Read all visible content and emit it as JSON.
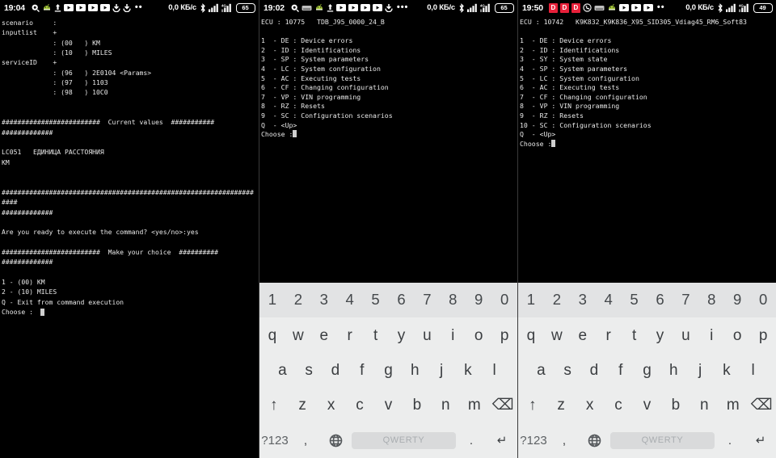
{
  "app": {
    "kind": "android-terminal-diagnostic-app",
    "screens": 3
  },
  "panels": [
    {
      "id": "panel-1",
      "statusbar": {
        "clock": "19:04",
        "net_rate": "0,0 КБ/c",
        "battery": "65",
        "icons": [
          "eye-notification-icon",
          "android-icon",
          "upload-icon",
          "video-icon",
          "video-icon",
          "video-icon",
          "video-icon",
          "download-icon",
          "download-icon",
          "more-dots-icon",
          "bluetooth-icon",
          "signal-bars-icon",
          "signal-4g-bars-icon",
          "battery-icon"
        ]
      },
      "terminal": "scenario     :\ninputlist    +\n             : (00   ) KM\n             : (10   ) MILES\nserviceID    +\n             : (96   ) 2E0104 <Params>\n             : (97   ) 1103\n             : (98   ) 10C0\n\n\n#########################  Current values  ###########\n#############\n\nLC051   ЕДИНИЦА РАССТОЯНИЯ\nKM\n\n\n####################################################################\n#############\n\nAre you ready to execute the command? <yes/no>:yes\n\n#########################  Make your choice  ##########\n#############\n\n1 - (00) KM\n2 - (10) MILES\nQ - Exit from command execution\nChoose :",
      "has_keyboard": false
    },
    {
      "id": "panel-2",
      "statusbar": {
        "clock": "19:02",
        "net_rate": "0,0 КБ/c",
        "battery": "65",
        "icons": [
          "eye-notification-icon",
          "keyboard-icon",
          "android-icon",
          "upload-icon",
          "video-icon",
          "video-icon",
          "video-icon",
          "video-icon",
          "download-icon",
          "more-dots-icon",
          "bluetooth-icon",
          "signal-bars-icon",
          "signal-4g-bars-icon",
          "battery-icon"
        ]
      },
      "terminal_header": "ECU : 10775   TDB_J95_0000_24_B",
      "menu": [
        "1  - DE : Device errors",
        "2  - ID : Identifications",
        "3  - SP : System parameters",
        "4  - LC : System configuration",
        "5  - AC : Executing tests",
        "6  - CF : Changing configuration",
        "7  - VP : VIN programming",
        "8  - RZ : Resets",
        "9  - SC : Configuration scenarios",
        "Q  - <Up>"
      ],
      "prompt": "Choose :",
      "has_keyboard": true
    },
    {
      "id": "panel-3",
      "statusbar": {
        "clock": "19:50",
        "net_rate": "0,0 КБ/c",
        "battery": "49",
        "badges": [
          "D",
          "D",
          "D"
        ],
        "icons": [
          "badge-d-icon",
          "badge-d-icon",
          "badge-d-icon",
          "viber-call-icon",
          "keyboard-icon",
          "android-icon",
          "video-icon",
          "video-icon",
          "video-icon",
          "more-dots-icon",
          "bluetooth-icon",
          "signal-bars-icon",
          "signal-4g-bars-icon",
          "battery-icon"
        ]
      },
      "terminal_header": "ECU : 10742   K9K832_K9K836_X95_SID305_Vdiag45_RM6_Soft83",
      "menu": [
        "1  - DE : Device errors",
        "2  - ID : Identifications",
        "3  - SY : System state",
        "4  - SP : System parameters",
        "5  - LC : System configuration",
        "6  - AC : Executing tests",
        "7  - CF : Changing configuration",
        "8  - VP : VIN programming",
        "9  - RZ : Resets",
        "10 - SC : Configuration scenarios",
        "Q  - <Up>"
      ],
      "prompt": "Choose :",
      "has_keyboard": true
    }
  ],
  "keyboard": {
    "row_numbers": [
      "1",
      "2",
      "3",
      "4",
      "5",
      "6",
      "7",
      "8",
      "9",
      "0"
    ],
    "row_top": [
      "q",
      "w",
      "e",
      "r",
      "t",
      "y",
      "u",
      "i",
      "o",
      "p"
    ],
    "row_home": [
      "a",
      "s",
      "d",
      "f",
      "g",
      "h",
      "j",
      "k",
      "l"
    ],
    "row_bottom": [
      "z",
      "x",
      "c",
      "v",
      "b",
      "n",
      "m"
    ],
    "shift_label": "↑",
    "backspace_label": "⌫",
    "symbols_label": "?123",
    "comma_label": ",",
    "globe_label": "globe-icon",
    "space_label": "QWERTY",
    "period_label": ".",
    "enter_label": "↵"
  },
  "colors": {
    "terminal_bg": "#000000",
    "terminal_fg": "#e9e9e9",
    "keyboard_bg": "#eceded",
    "keyboard_numrow_bg": "#e2e3e4",
    "key_text": "#3b3e41",
    "space_bg": "#d9dadb",
    "badge_red": "#e8203a"
  }
}
